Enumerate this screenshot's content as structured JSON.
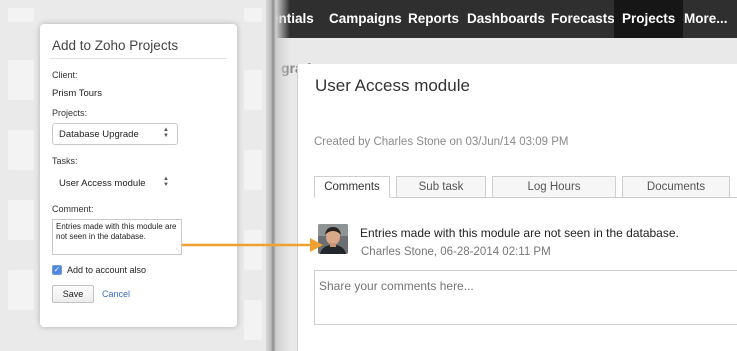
{
  "nav": {
    "items": [
      {
        "label": "entials"
      },
      {
        "label": "Campaigns"
      },
      {
        "label": "Reports"
      },
      {
        "label": "Dashboards"
      },
      {
        "label": "Forecasts"
      },
      {
        "label": "Projects"
      },
      {
        "label": "More..."
      }
    ],
    "active": "Projects"
  },
  "breadcrumb": "grade ›",
  "task": {
    "title": "User Access module",
    "created": "Created by Charles Stone on 03/Jun/14 03:09 PM",
    "tabs": [
      "Comments",
      "Sub task",
      "Log Hours",
      "Documents"
    ],
    "active_tab": "Comments"
  },
  "comment": {
    "text": "Entries made with this module are not seen in the database.",
    "author": "Charles Stone,",
    "timestamp": "06-28-2014 02:11 PM",
    "avatar_icon": "user-avatar-icon"
  },
  "new_comment": {
    "placeholder": "Share your comments here..."
  },
  "popup": {
    "title": "Add to Zoho Projects",
    "client_label": "Client:",
    "client_value": "Prism Tours",
    "projects_label": "Projects:",
    "project_value": "Database Upgrade",
    "tasks_label": "Tasks:",
    "task_value": "User Access module",
    "comment_label": "Comment:",
    "comment_value": "Entries made with this module are not seen in the database.",
    "checkbox_label": "Add to account also",
    "checkbox_checked": true,
    "save_label": "Save",
    "cancel_label": "Cancel"
  },
  "colors": {
    "nav_bg": "#2f2f2f",
    "arrow": "#f0a030",
    "link": "#3b6cc4"
  }
}
